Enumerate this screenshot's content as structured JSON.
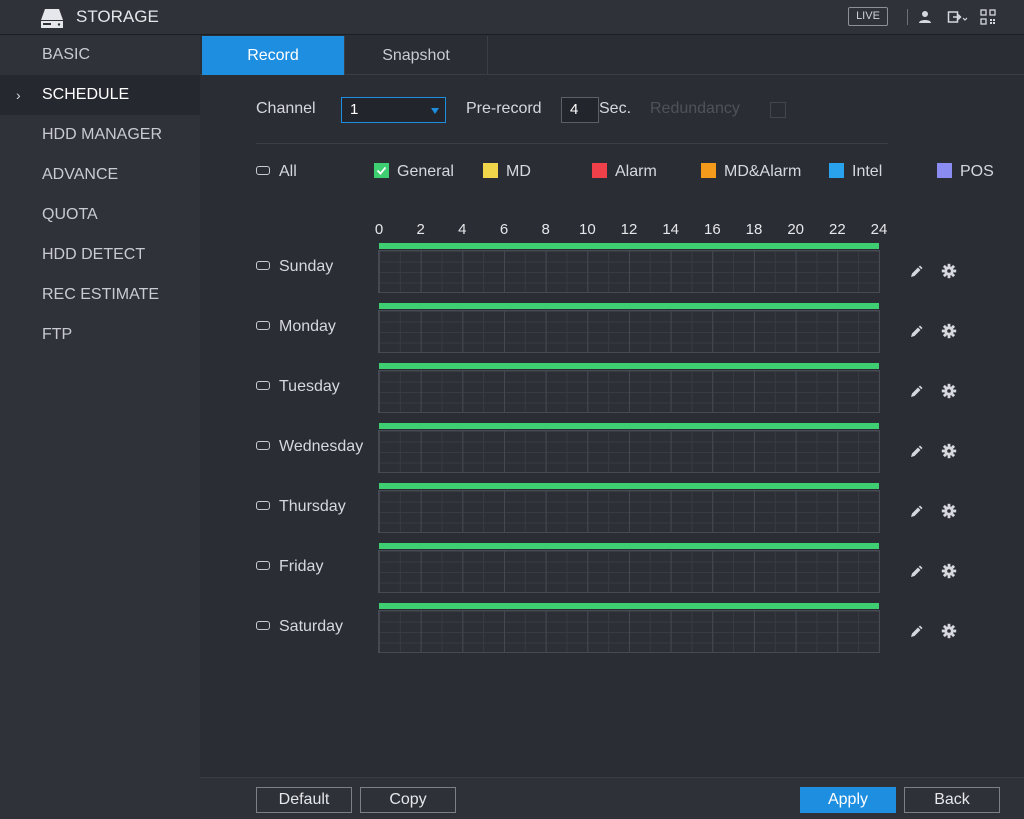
{
  "header": {
    "title": "STORAGE",
    "live_label": "LIVE"
  },
  "sidebar": {
    "items": [
      {
        "label": "BASIC",
        "active": false
      },
      {
        "label": "SCHEDULE",
        "active": true
      },
      {
        "label": "HDD MANAGER",
        "active": false
      },
      {
        "label": "ADVANCE",
        "active": false
      },
      {
        "label": "QUOTA",
        "active": false
      },
      {
        "label": "HDD DETECT",
        "active": false
      },
      {
        "label": "REC ESTIMATE",
        "active": false
      },
      {
        "label": "FTP",
        "active": false
      }
    ]
  },
  "tabs": [
    {
      "label": "Record",
      "active": true
    },
    {
      "label": "Snapshot",
      "active": false
    }
  ],
  "controls": {
    "channel_label": "Channel",
    "channel_value": "1",
    "prerecord_label": "Pre-record",
    "prerecord_value": "4",
    "prerecord_unit": "Sec.",
    "redundancy_label": "Redundancy"
  },
  "legend": [
    {
      "label": "All",
      "type": "pill"
    },
    {
      "label": "General",
      "type": "check",
      "color": "#3fcf73",
      "checked": true
    },
    {
      "label": "MD",
      "type": "swatch",
      "color": "#f1d54a"
    },
    {
      "label": "Alarm",
      "type": "swatch",
      "color": "#f0404a"
    },
    {
      "label": "MD&Alarm",
      "type": "swatch",
      "color": "#f59b1c"
    },
    {
      "label": "Intel",
      "type": "swatch",
      "color": "#2aa3ee"
    },
    {
      "label": "POS",
      "type": "swatch",
      "color": "#8b8cf2"
    }
  ],
  "hours": [
    "0",
    "2",
    "4",
    "6",
    "8",
    "10",
    "12",
    "14",
    "16",
    "18",
    "20",
    "22",
    "24"
  ],
  "days": [
    {
      "label": "Sunday",
      "general_start": 0,
      "general_end": 24
    },
    {
      "label": "Monday",
      "general_start": 0,
      "general_end": 24
    },
    {
      "label": "Tuesday",
      "general_start": 0,
      "general_end": 24
    },
    {
      "label": "Wednesday",
      "general_start": 0,
      "general_end": 24
    },
    {
      "label": "Thursday",
      "general_start": 0,
      "general_end": 24
    },
    {
      "label": "Friday",
      "general_start": 0,
      "general_end": 24
    },
    {
      "label": "Saturday",
      "general_start": 0,
      "general_end": 24
    }
  ],
  "row_icons": [
    "pencil-icon",
    "gear-icon"
  ],
  "buttons": {
    "default": "Default",
    "copy": "Copy",
    "apply": "Apply",
    "back": "Back"
  },
  "colors": {
    "accent": "#1e8fe0",
    "general": "#3fcf73"
  }
}
